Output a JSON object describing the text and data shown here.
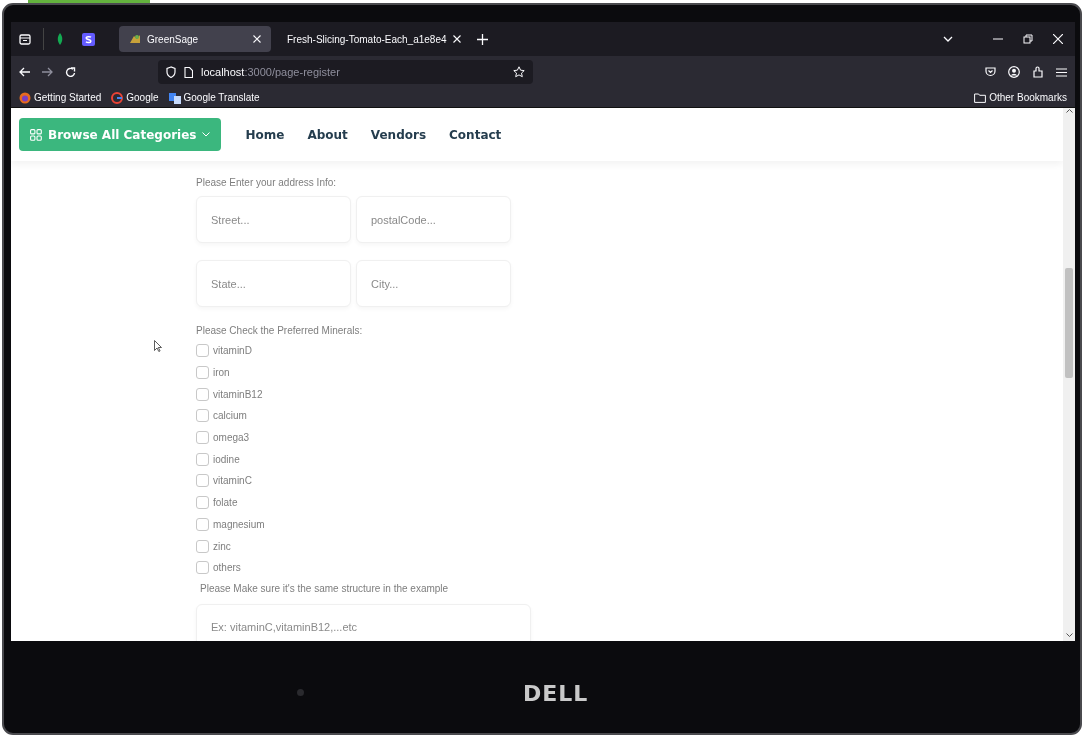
{
  "browser": {
    "tabs": [
      {
        "title": "GreenSage",
        "selected": true
      },
      {
        "title": "Fresh-Slicing-Tomato-Each_a1e8e4",
        "selected": false
      }
    ],
    "address": {
      "host": "localhost",
      "path": ":3000/page-register"
    },
    "bookmarks": [
      "Getting Started",
      "Google",
      "Google Translate"
    ],
    "other_bookmarks": "Other Bookmarks"
  },
  "header": {
    "category_button": "Browse All Categories",
    "nav": [
      "Home",
      "About",
      "Vendors",
      "Contact"
    ]
  },
  "form": {
    "address_prompt": "Please Enter your address Info:",
    "address_fields": [
      {
        "placeholder": "Street..."
      },
      {
        "placeholder": "postalCode..."
      },
      {
        "placeholder": "State..."
      },
      {
        "placeholder": "City..."
      }
    ],
    "minerals_prompt": "Please Check the Preferred Minerals:",
    "minerals": [
      {
        "label": "vitaminD",
        "checked": false
      },
      {
        "label": "iron",
        "checked": false
      },
      {
        "label": "vitaminB12",
        "checked": false
      },
      {
        "label": "calcium",
        "checked": false
      },
      {
        "label": "omega3",
        "checked": false
      },
      {
        "label": "iodine",
        "checked": false
      },
      {
        "label": "vitaminC",
        "checked": false
      },
      {
        "label": "folate",
        "checked": false
      },
      {
        "label": "magnesium",
        "checked": false
      },
      {
        "label": "zinc",
        "checked": false
      },
      {
        "label": "others",
        "checked": false
      }
    ],
    "structure_hint": "Please Make sure it's the same structure in the example",
    "example_field": {
      "placeholder": "Ex: vitaminC,vitaminB12,...etc"
    }
  },
  "bezel": {
    "logo": "DELL"
  }
}
